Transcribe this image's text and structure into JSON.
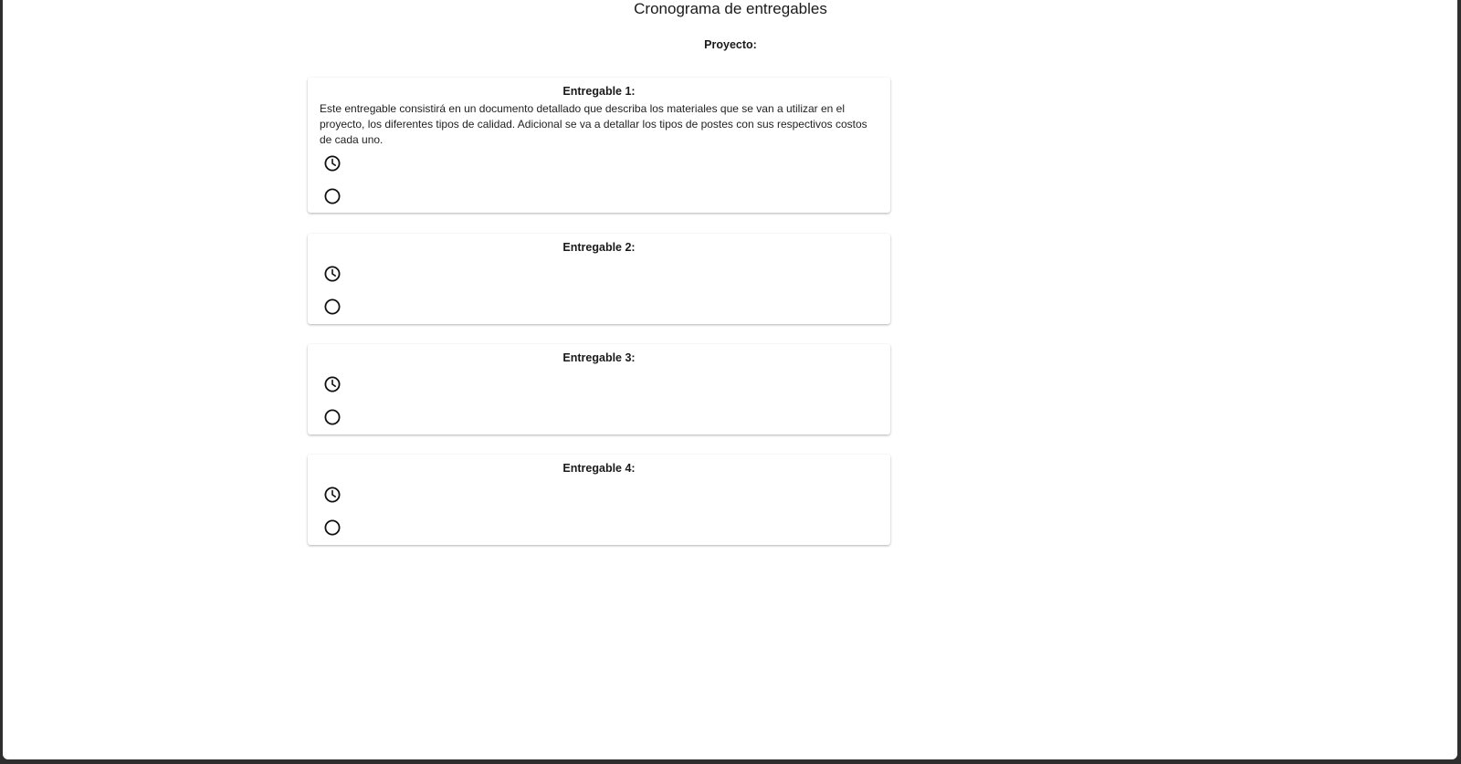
{
  "page": {
    "title": "Cronograma de entregables",
    "project_label": "Proyecto:"
  },
  "deliverables": [
    {
      "title": "Entregable 1:",
      "description": "Este entregable consistirá en un documento detallado que describa los materiales que se van a utilizar en el proyecto, los diferentes tipos de calidad. Adicional se va a detallar los tipos de postes con sus respectivos costos de cada uno.",
      "icons": [
        "clock-icon",
        "circle-icon"
      ]
    },
    {
      "title": "Entregable 2:",
      "description": "",
      "icons": [
        "clock-icon",
        "circle-icon"
      ]
    },
    {
      "title": "Entregable 3:",
      "description": "",
      "icons": [
        "clock-icon",
        "circle-icon"
      ]
    },
    {
      "title": "Entregable 4:",
      "description": "",
      "icons": [
        "clock-icon",
        "circle-icon"
      ]
    }
  ],
  "colors": {
    "background": "#ffffff",
    "frame": "#2e2e2e",
    "text": "#1a1a1a"
  }
}
